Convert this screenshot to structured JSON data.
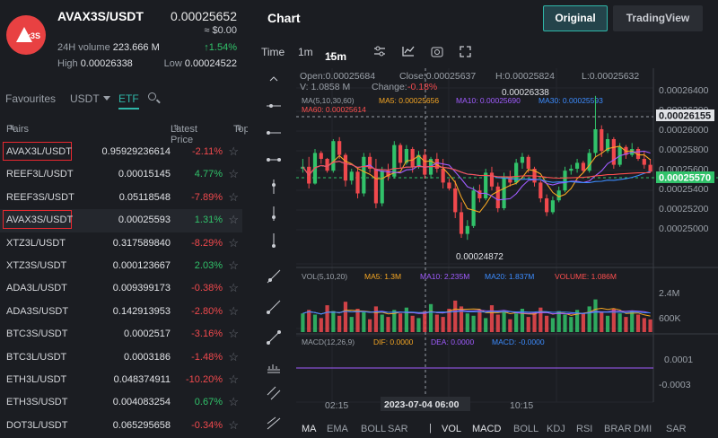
{
  "header": {
    "logo_badge": "x3S",
    "symbol": "AVAX3S/USDT",
    "price": "0.00025652",
    "usd": "≈ $0.00",
    "vol_label": "24H volume",
    "vol_value": "223.666 M",
    "change": "↑1.54%",
    "high_label": "High",
    "high_value": "0.00026338",
    "low_label": "Low",
    "low_value": "0.00024522"
  },
  "filters": {
    "favourites": "Favourites",
    "quote": "USDT",
    "etf": "ETF",
    "search_icon": "search-icon"
  },
  "table": {
    "col_pairs": "Pairs",
    "col_price": "Latest Price",
    "col_top": "Top",
    "rows": [
      {
        "pair": "AVAX3L/USDT",
        "price": "0.95929236614",
        "change": "-2.11%",
        "dir": "down",
        "boxed": true
      },
      {
        "pair": "REEF3L/USDT",
        "price": "0.00015145",
        "change": "4.77%",
        "dir": "up"
      },
      {
        "pair": "REEF3S/USDT",
        "price": "0.05118548",
        "change": "-7.89%",
        "dir": "down"
      },
      {
        "pair": "AVAX3S/USDT",
        "price": "0.00025593",
        "change": "1.31%",
        "dir": "up",
        "boxed": true,
        "selected": true
      },
      {
        "pair": "XTZ3L/USDT",
        "price": "0.317589840",
        "change": "-8.29%",
        "dir": "down"
      },
      {
        "pair": "XTZ3S/USDT",
        "price": "0.000123667",
        "change": "2.03%",
        "dir": "up"
      },
      {
        "pair": "ADA3L/USDT",
        "price": "0.009399173",
        "change": "-0.38%",
        "dir": "down"
      },
      {
        "pair": "ADA3S/USDT",
        "price": "0.142913953",
        "change": "-2.80%",
        "dir": "down"
      },
      {
        "pair": "BTC3S/USDT",
        "price": "0.0002517",
        "change": "-3.16%",
        "dir": "down"
      },
      {
        "pair": "BTC3L/USDT",
        "price": "0.0003186",
        "change": "-1.48%",
        "dir": "down"
      },
      {
        "pair": "ETH3L/USDT",
        "price": "0.048374911",
        "change": "-10.20%",
        "dir": "down"
      },
      {
        "pair": "ETH3S/USDT",
        "price": "0.004083254",
        "change": "0.67%",
        "dir": "up"
      },
      {
        "pair": "DOT3L/USDT",
        "price": "0.065295658",
        "change": "-0.34%",
        "dir": "down"
      }
    ]
  },
  "chart_panel": {
    "title": "Chart",
    "original": "Original",
    "tradingview": "TradingView",
    "time_label": "Time",
    "interval_1m": "1m",
    "interval_15m": "15m"
  },
  "ohlc": {
    "open": "Open:0.00025684",
    "close": "Close:0.00025637",
    "high": "H:0.00025824",
    "low": "L:0.00025632",
    "vol": "V: 1.0858 M",
    "change_label": "Change:",
    "change": "-0.18%"
  },
  "ma": {
    "label": "MA(5,10,30,60)",
    "ma5": "MA5: 0.00025656",
    "ma10": "MA10: 0.00025690",
    "ma30": "MA30: 0.00025593",
    "ma60": "MA60: 0.00025614"
  },
  "volume": {
    "label": "VOL(5,10,20)",
    "ma5": "MA5: 1.3M",
    "ma10": "MA10: 2.235M",
    "ma20": "MA20: 1.837M",
    "volume": "VOLUME: 1.086M",
    "tick_hi": "2.4M",
    "tick_lo": "600K"
  },
  "macd": {
    "label": "MACD(12,26,9)",
    "dif": "DIF: 0.0000",
    "dea": "DEA: 0.0000",
    "macd": "MACD: -0.0000",
    "tick_hi": "0.0001",
    "tick_lo": "-0.0003"
  },
  "price_axis": {
    "ticks": [
      "0.00026400",
      "0.00026200",
      "0.00026000",
      "0.00025800",
      "0.00025600",
      "0.00025400",
      "0.00025200",
      "0.00025000"
    ],
    "crosshair": "0.00026155",
    "last": "0.00025570",
    "max_label": "0.00026338",
    "min_label": "0.00024872"
  },
  "time_axis": {
    "t1": "02:15",
    "t2": "2023-07-04 06:00",
    "t3": "10:15"
  },
  "indicators": [
    "MA",
    "EMA",
    "BOLL",
    "SAR",
    "VOL",
    "MACD",
    "BOLL",
    "KDJ",
    "RSI",
    "BRAR",
    "DMI",
    "SAR"
  ],
  "colors": {
    "accent": "#2fb6a8",
    "up": "#31c26a",
    "down": "#f0494d",
    "ma5": "#f5a623",
    "ma10": "#a05cff",
    "ma30": "#3c8cff",
    "ma60": "#ff4f4f"
  }
}
